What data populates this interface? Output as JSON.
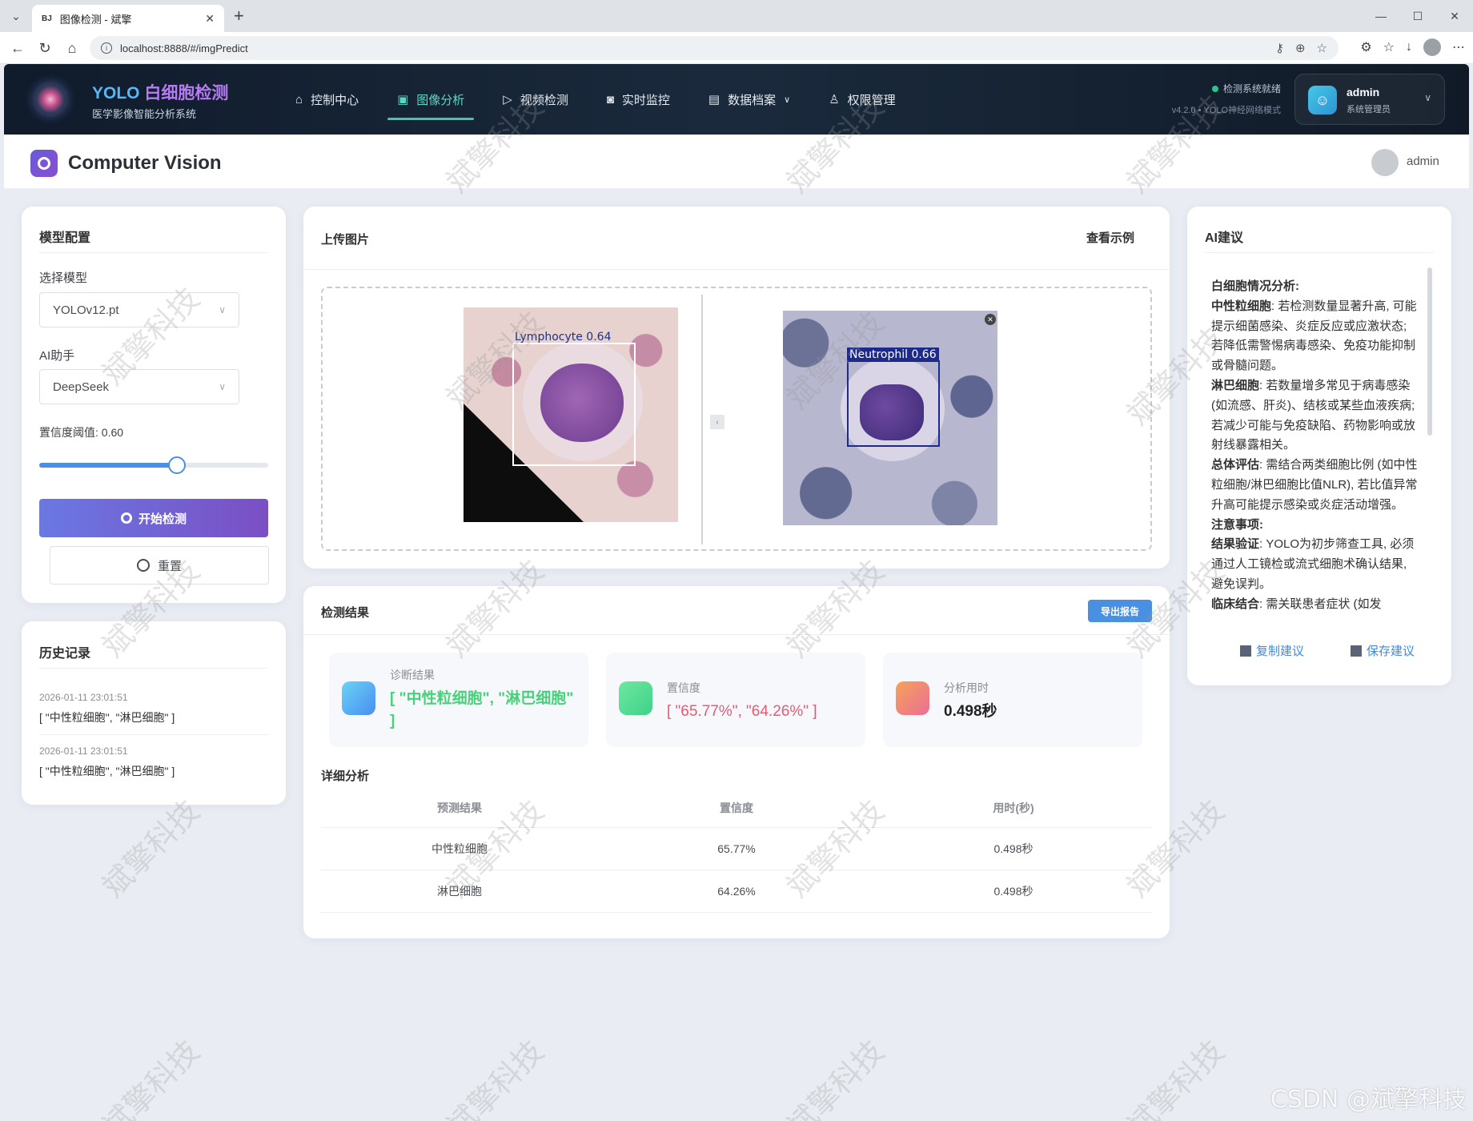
{
  "browser": {
    "tab_title": "图像检测 - 斌擎",
    "tab_favicon": "BJ",
    "url": "localhost:8888/#/imgPredict"
  },
  "app": {
    "brand_prefix": "YOLO ",
    "brand_highlight": "白细胞检测",
    "brand_sub": "医学影像智能分析系统",
    "nav": [
      {
        "label": "控制中心",
        "icon": "home-icon"
      },
      {
        "label": "图像分析",
        "icon": "image-icon",
        "active": true
      },
      {
        "label": "视频检测",
        "icon": "play-icon"
      },
      {
        "label": "实时监控",
        "icon": "camera-icon"
      },
      {
        "label": "数据档案",
        "icon": "document-icon"
      },
      {
        "label": "权限管理",
        "icon": "user-icon"
      }
    ],
    "status": "检测系统就绪",
    "version": "v4.2.0 • YOLO神经网络模式",
    "user_name": "admin",
    "user_role": "系统管理员",
    "status_color": "#25c78c"
  },
  "subheader": {
    "title": "Computer Vision",
    "user": "admin"
  },
  "config": {
    "title": "模型配置",
    "model_label": "选择模型",
    "model_value": "YOLOv12.pt",
    "assistant_label": "AI助手",
    "assistant_value": "DeepSeek",
    "threshold_label": "置信度阈值: 0.60",
    "threshold": 0.6,
    "detect_button": "开始检测",
    "reset_button": "重置"
  },
  "history": {
    "title": "历史记录",
    "items": [
      {
        "time": "2026-01-11 23:01:51",
        "result": "[ \"中性粒细胞\", \"淋巴细胞\" ]"
      },
      {
        "time": "2026-01-11 23:01:51",
        "result": "[ \"中性粒细胞\", \"淋巴细胞\" ]"
      }
    ]
  },
  "upload": {
    "title": "上传图片",
    "example_link": "查看示例",
    "detections": [
      {
        "label": "Lymphocyte  0.64",
        "color": "#ffffff"
      },
      {
        "label": "Neutrophil  0.66",
        "color": "#1d2a8a"
      }
    ]
  },
  "results": {
    "title": "检测结果",
    "export_button": "导出报告",
    "diag_label": "诊断结果",
    "diag_value": "[ \"中性粒细胞\", \"淋巴细胞\" ]",
    "conf_label": "置信度",
    "conf_value": "[ \"65.77%\", \"64.26%\" ]",
    "time_label": "分析用时",
    "time_value": "0.498秒",
    "detail_title": "详细分析",
    "columns": [
      "预测结果",
      "置信度",
      "用时(秒)"
    ],
    "rows": [
      [
        "中性粒细胞",
        "65.77%",
        "0.498秒"
      ],
      [
        "淋巴细胞",
        "64.26%",
        "0.498秒"
      ]
    ]
  },
  "ai": {
    "title": "AI建议",
    "heading": "白细胞情况分析:",
    "p1_b": "中性粒细胞",
    "p1": ": 若检测数量显著升高, 可能提示细菌感染、炎症反应或应激状态; 若降低需警惕病毒感染、免疫功能抑制或骨髓问题。",
    "p2_b": "淋巴细胞",
    "p2": ": 若数量增多常见于病毒感染 (如流感、肝炎)、结核或某些血液疾病; 若减少可能与免疫缺陷、药物影响或放射线暴露相关。",
    "p3_b": "总体评估",
    "p3": ": 需结合两类细胞比例 (如中性粒细胞/淋巴细胞比值NLR), 若比值异常升高可能提示感染或炎症活动增强。",
    "heading2": "注意事项:",
    "p4_b": "结果验证",
    "p4": ": YOLO为初步筛查工具, 必须通过人工镜检或流式细胞术确认结果, 避免误判。",
    "p5_b": "临床结合",
    "p5": ": 需关联患者症状 (如发",
    "copy_button": "复制建议",
    "save_button": "保存建议"
  },
  "watermark": "斌擎科技",
  "footer_mark": "CSDN @斌擎科技"
}
